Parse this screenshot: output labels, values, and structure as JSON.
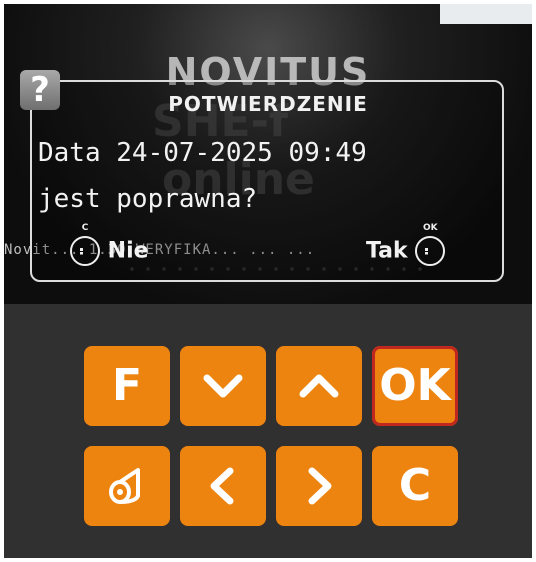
{
  "screen": {
    "brand": "NOVITUS",
    "ticker": "Novit... 1.30 WERYFIKA... ... ...",
    "dialog": {
      "icon": "?",
      "title": "POTWIERDZENIE",
      "line1": "Data 24-07-2025 09:49",
      "line2": "jest poprawna?",
      "no_key_label": "C",
      "no_label": "Nie",
      "yes_label": "Tak",
      "yes_key_label": "OK"
    }
  },
  "keypad": {
    "f_label": "F",
    "ok_label": "OK",
    "c_label": "C",
    "keys": [
      "f-key",
      "down-arrow-icon",
      "up-arrow-icon",
      "ok-key",
      "paper-roll-icon",
      "left-arrow-icon",
      "right-arrow-icon",
      "c-key"
    ]
  },
  "colors": {
    "key": "#ee8410",
    "ok_outline": "#c0281f",
    "panel": "#303030"
  }
}
